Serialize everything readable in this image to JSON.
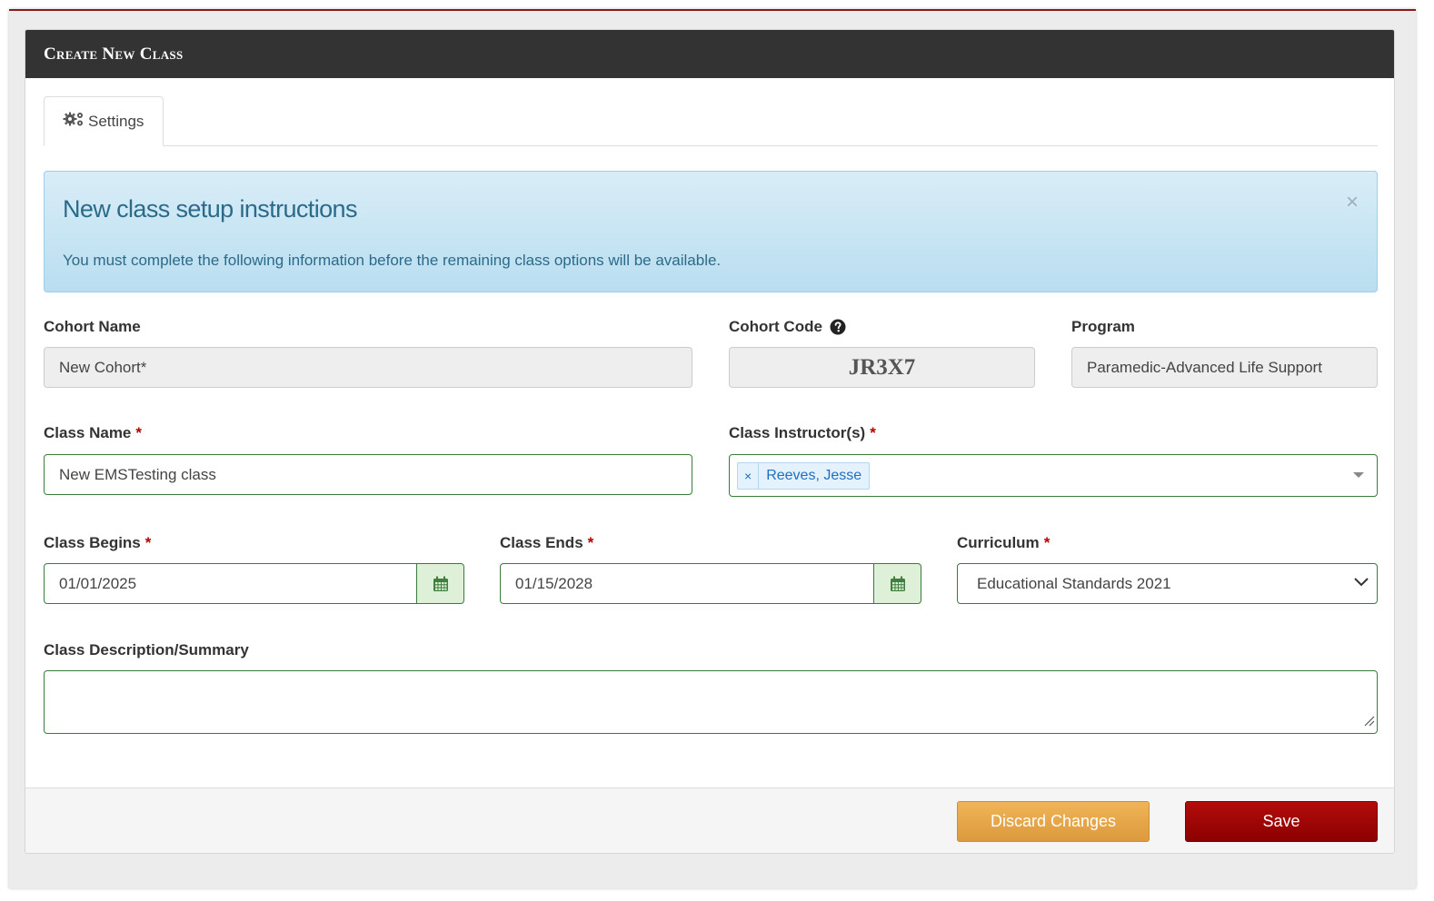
{
  "header": {
    "title": "Create New Class"
  },
  "tabs": [
    {
      "label": "Settings",
      "icon": "gears-icon"
    }
  ],
  "alert": {
    "title": "New class setup instructions",
    "text": "You must complete the following information before the remaining class options will be available.",
    "close": "×"
  },
  "form": {
    "cohort_name": {
      "label": "Cohort Name",
      "value": "New Cohort*"
    },
    "cohort_code": {
      "label": "Cohort Code",
      "value": "JR3X7",
      "help_icon": "question-circle-icon"
    },
    "program": {
      "label": "Program",
      "value": "Paramedic-Advanced Life Support"
    },
    "class_name": {
      "label": "Class Name",
      "required_mark": "*",
      "value": "New EMSTesting class"
    },
    "instructors": {
      "label": "Class Instructor(s)",
      "required_mark": "*",
      "selected": [
        {
          "remove": "×",
          "name": "Reeves, Jesse"
        }
      ]
    },
    "class_begins": {
      "label": "Class Begins",
      "required_mark": "*",
      "value": "01/01/2025"
    },
    "class_ends": {
      "label": "Class Ends",
      "required_mark": "*",
      "value": "01/15/2028"
    },
    "curriculum": {
      "label": "Curriculum",
      "required_mark": "*",
      "value": "Educational Standards 2021"
    },
    "description": {
      "label": "Class Description/Summary",
      "value": ""
    }
  },
  "footer": {
    "discard_label": "Discard Changes",
    "save_label": "Save"
  },
  "colors": {
    "header_bg": "#333333",
    "accent_red": "#8b1a1a",
    "required": "#b30000",
    "alert_bg": "#d9edf7",
    "field_border": "#3a7d3a",
    "discard": "#e8a84a",
    "save": "#a00000"
  }
}
